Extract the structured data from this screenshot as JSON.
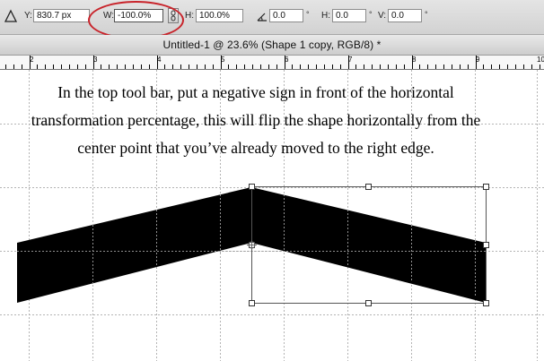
{
  "options_bar": {
    "shape_tool_icon": "triangle-warp-icon",
    "y_label": "Y:",
    "y_value": "830.7 px",
    "w_label": "W:",
    "w_value": "-100.0%",
    "link_icon": "chain-link-icon",
    "h_label": "H:",
    "h_value": "100.0%",
    "rotate_icon": "angle-icon",
    "rotate_value": "0.0",
    "degree_symbol": "°",
    "skew_h_label": "H:",
    "skew_h_value": "0.0",
    "skew_v_label": "V:",
    "skew_v_value": "0.0",
    "highlight_color": "#c8242b"
  },
  "document": {
    "title": "Untitled-1 @ 23.6% (Shape 1 copy, RGB/8) *"
  },
  "ruler": {
    "labels": [
      "2",
      "3",
      "4",
      "5",
      "6",
      "7",
      "8",
      "9",
      "10"
    ]
  },
  "canvas": {
    "instruction": "In the top tool bar, put a negative sign in front of the horizontal transformation percentage, this will flip the shape horizontally from the center point that you’ve already moved to the right edge."
  }
}
